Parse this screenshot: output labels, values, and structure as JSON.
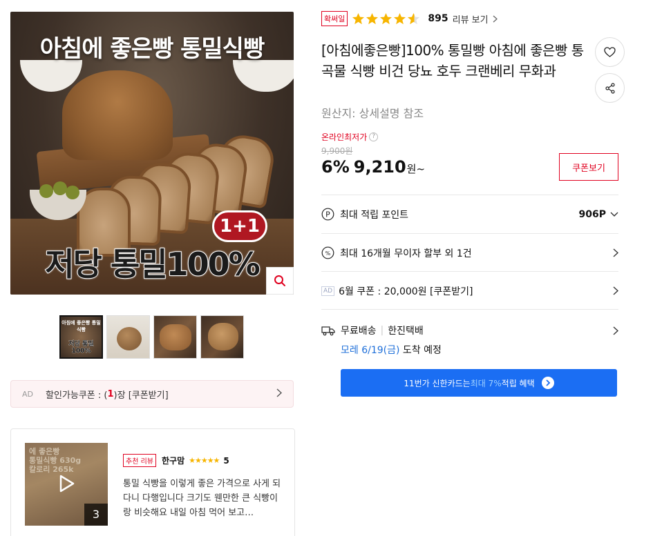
{
  "product_image": {
    "headline": "아침에 좋은빵 통밀식빵",
    "badge": "1+1",
    "subtitle": "저당 통밀100%"
  },
  "thumbnails": [
    {
      "top_text": "아침에 좋은빵 통밀식빵",
      "bottom_text": "저당 통밀100%",
      "active": true
    },
    {
      "active": false
    },
    {
      "active": false
    },
    {
      "active": false
    }
  ],
  "ad_coupon": {
    "ad_label": "AD",
    "text_prefix": "할인가능쿠폰 : (",
    "count": "1",
    "text_suffix": ")장 [쿠폰받기]"
  },
  "review_preview": {
    "video_text": "에 좋은빵\n통밀식빵 630g\n칼로리 265k",
    "media_count": "3",
    "recommend_label": "추천 리뷰",
    "reviewer": "한구맘",
    "stars": "★★★★★",
    "score": "5",
    "text": "통밀 식빵을 이렇게 좋은 가격으로 사게 되다니 다행입니다 크기도 웬만한 큰 식빵이랑 비슷해요 내일 아침 먹어 보고…"
  },
  "rating": {
    "confirm_label": "확써일",
    "stars_value": 4.5,
    "count": "895",
    "link_label": "리뷰 보기"
  },
  "product": {
    "title": "[아침에좋은빵]100% 통밀빵 아침에 좋은빵 통곡물 식빵 비건 당뇨 호두 크랜베리 무화과",
    "origin": "원산지:  상세설명 참조"
  },
  "price": {
    "lowest_label": "온라인최저가",
    "original": "9,900원",
    "discount": "6%",
    "current": "9,210",
    "unit": "원~",
    "coupon_button": "쿠폰보기"
  },
  "benefits": {
    "points_label": "최대 적립 포인트",
    "points_value": "906P",
    "installment_label": "최대 16개월 무이자 할부 외 1건",
    "ad_label": "AD",
    "coupon_label": "6월 쿠폰 : 20,000원 [쿠폰받기]"
  },
  "shipping": {
    "free_label": "무료배송",
    "carrier": "한진택배",
    "date": "모레 6/19(금)",
    "arrival_suffix": "도착 예정"
  },
  "card_banner": {
    "prefix": "11번가 신한카드는 ",
    "highlight": "최대 7%",
    "suffix": " 적립 혜택"
  },
  "colors": {
    "accent_red": "#e0001f",
    "star_yellow": "#f7b500",
    "banner_blue": "#1b6ef3",
    "link_blue": "#1e6fd9"
  }
}
